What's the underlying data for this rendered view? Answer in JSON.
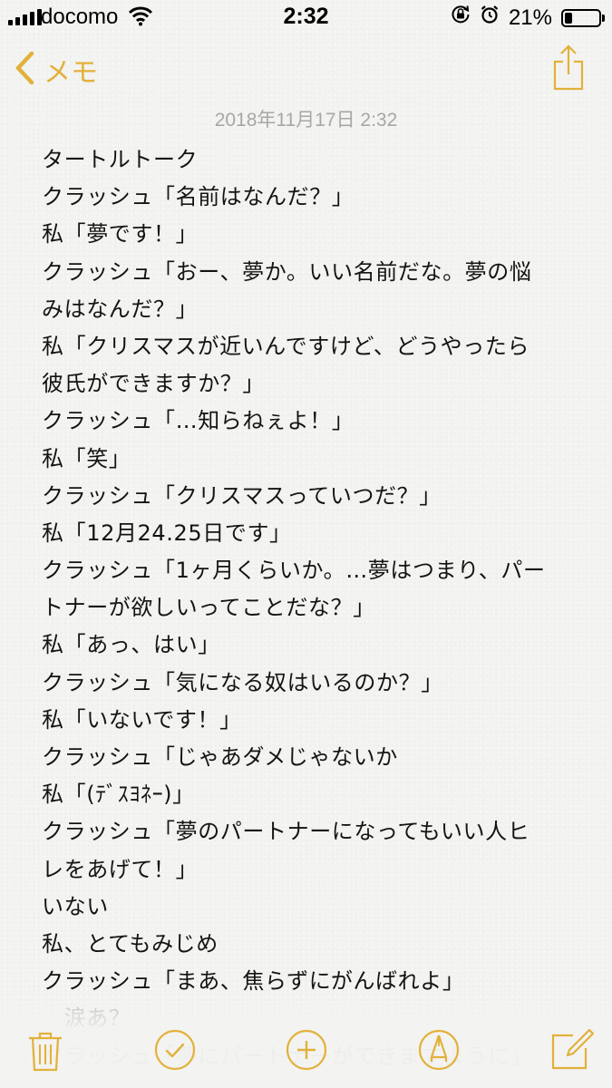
{
  "status_bar": {
    "carrier": "docomo",
    "time": "2:32",
    "battery_percent": "21%",
    "battery_level": 0.21
  },
  "nav": {
    "back_label": "メモ"
  },
  "note": {
    "date": "2018年11月17日 2:32",
    "lines": [
      "タートルトーク",
      "クラッシュ「名前はなんだ？」",
      "私「夢です！」",
      "クラッシュ「おー、夢か。いい名前だな。夢の悩",
      "みはなんだ？」",
      "私「クリスマスが近いんですけど、どうやったら",
      "彼氏ができますか？」",
      "クラッシュ「…知らねぇよ！」",
      "私「笑」",
      "クラッシュ「クリスマスっていつだ？」",
      "私「12月24.25日です」",
      "クラッシュ「1ヶ月くらいか。…夢はつまり、パー",
      "トナーが欲しいってことだな？」",
      "私「あっ、はい」",
      "クラッシュ「気になる奴はいるのか？」",
      "私「いないです！」",
      "クラッシュ「じゃあダメじゃないか",
      "私「(ﾃﾞｽﾖﾈｰ)」",
      "クラッシュ「夢のパートナーになってもいい人ヒ",
      "レをあげて！」",
      "いない",
      "私、とてもみじめ",
      "クラッシュ「まあ、焦らずにがんばれよ」",
      "　涙あ？",
      "クラッシュ「夢にパートナーができますように」"
    ]
  },
  "colors": {
    "accent": "#e2b13a",
    "text": "#141414",
    "date": "#a7a7a7",
    "background": "#f3f3f1"
  },
  "icons": {
    "back": "chevron-left-icon",
    "share": "share-icon",
    "trash": "trash-icon",
    "checklist": "checkmark-circle-icon",
    "add": "plus-circle-icon",
    "sketch": "pen-tip-circle-icon",
    "compose": "compose-icon"
  }
}
